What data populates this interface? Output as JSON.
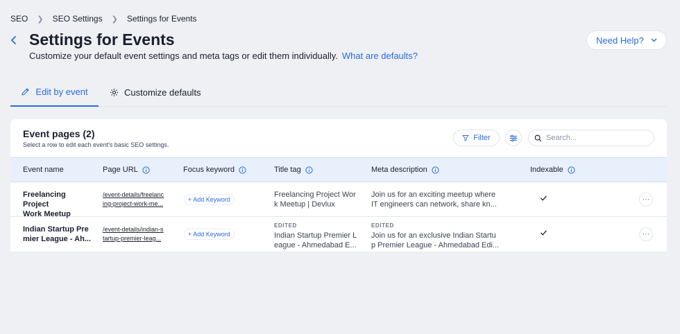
{
  "breadcrumb": [
    "SEO",
    "SEO Settings",
    "Settings for Events"
  ],
  "page": {
    "title": "Settings for Events",
    "subtitle": "Customize your default event settings and meta tags or edit them individually.",
    "subtitle_link": "What are defaults?"
  },
  "help_button": "Need Help?",
  "tabs": [
    {
      "label": "Edit by event",
      "icon": "pencil-icon",
      "active": true
    },
    {
      "label": "Customize defaults",
      "icon": "gear-icon",
      "active": false
    }
  ],
  "card": {
    "title": "Event pages (2)",
    "subtitle": "Select a row to edit each event's basic SEO settings.",
    "filter_label": "Filter",
    "search_placeholder": "Search..."
  },
  "table": {
    "columns": [
      "Event name",
      "Page URL",
      "Focus keyword",
      "Title tag",
      "Meta description",
      "Indexable"
    ],
    "rows": [
      {
        "name_1": "Freelancing Project",
        "name_2": "Work Meetup",
        "url_1": "/event-details/freelanc",
        "url_2": "ing-project-work-me...",
        "keyword": "+ Add Keyword",
        "title_edited": "",
        "title_1": "Freelancing Project Wor",
        "title_2": "k Meetup | Devlux",
        "meta_edited": "",
        "meta_1": "Join us for an exciting meetup where",
        "meta_2": "IT engineers can network, share kn...",
        "indexable": true
      },
      {
        "name_1": "Indian Startup Pre",
        "name_2": "mier League - Ah...",
        "url_1": "/event-details/indian-s",
        "url_2": "tartup-premier-leag...",
        "keyword": "+ Add Keyword",
        "title_edited": "EDITED",
        "title_1": "Indian Startup Premier L",
        "title_2": "eague - Ahmedabad E...",
        "meta_edited": "EDITED",
        "meta_1": "Join us for an exclusive Indian Startu",
        "meta_2": "p Premier League - Ahmedabad Edi...",
        "indexable": true
      }
    ]
  },
  "colors": {
    "accent": "#2b6ae0",
    "background": "#eef0f4",
    "header_row": "#e8f0fc"
  }
}
